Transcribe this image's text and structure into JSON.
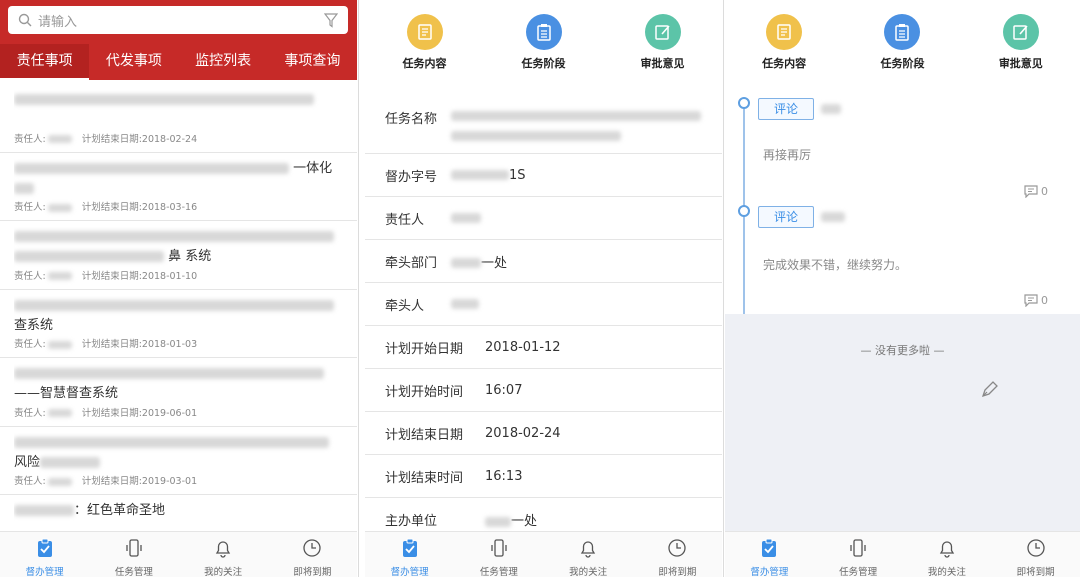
{
  "panel1": {
    "search_placeholder": "请输入",
    "tabs": [
      "责任事项",
      "代发事项",
      "监控列表",
      "事项查询"
    ],
    "items": [
      {
        "title_visible": "",
        "owner_label": "责任人:",
        "date_label": "计划结束日期:2018-02-24"
      },
      {
        "title_visible": "一体化",
        "owner_label": "责任人:",
        "date_label": "计划结束日期:2018-03-16"
      },
      {
        "title_visible": "鼻 系统",
        "owner_label": "责任人:",
        "date_label": "计划结束日期:2018-01-10"
      },
      {
        "title_visible": "查系统",
        "owner_label": "责任人:",
        "date_label": "计划结束日期:2018-01-03"
      },
      {
        "title_visible": "——智慧督查系统",
        "owner_label": "责任人:",
        "date_label": "计划结束日期:2019-06-01"
      },
      {
        "title_visible": "风险",
        "owner_label": "责任人:",
        "date_label": "计划结束日期:2019-03-01"
      },
      {
        "title_visible": "：红色革命圣地",
        "owner_label": "",
        "date_label": ""
      }
    ]
  },
  "icons": [
    "任务内容",
    "任务阶段",
    "审批意见"
  ],
  "icon_colors": [
    "#f0c14b",
    "#4a90e2",
    "#5cc4a8"
  ],
  "panel2": {
    "rows": [
      {
        "key": "任务名称",
        "value": ""
      },
      {
        "key": "督办字号",
        "value": "1S"
      },
      {
        "key": "责任人",
        "value": ""
      },
      {
        "key": "牵头部门",
        "value": "一处"
      },
      {
        "key": "牵头人",
        "value": ""
      },
      {
        "key": "计划开始日期",
        "value": "2018-01-12"
      },
      {
        "key": "计划开始时间",
        "value": "16:07"
      },
      {
        "key": "计划结束日期",
        "value": "2018-02-24"
      },
      {
        "key": "计划结束时间",
        "value": "16:13"
      },
      {
        "key": "主办单位",
        "value": "一处"
      }
    ]
  },
  "panel3": {
    "comments": [
      {
        "button": "评论",
        "text": "再接再厉",
        "count": "0"
      },
      {
        "button": "评论",
        "text": "完成效果不错，继续努力。",
        "count": "0"
      }
    ],
    "no_more": "—  没有更多啦  —"
  },
  "nav": [
    "督办管理",
    "任务管理",
    "我的关注",
    "即将到期"
  ],
  "colors": {
    "brand_red": "#c62a28",
    "accent_blue": "#3a8ee6"
  }
}
